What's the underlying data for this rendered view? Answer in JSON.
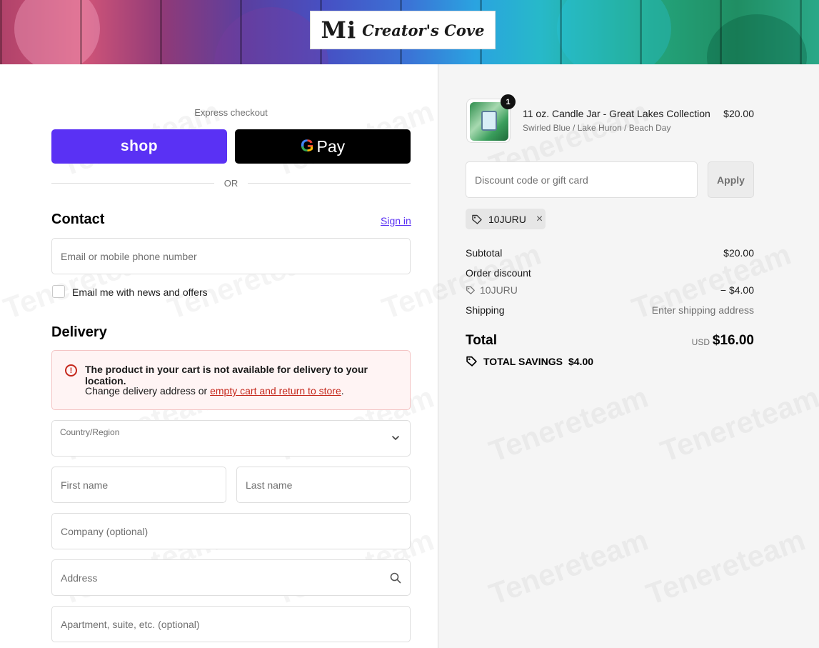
{
  "header": {
    "logo_main": "Mi",
    "logo_sub": "Creator's Cove"
  },
  "express": {
    "label": "Express checkout",
    "shop_label": "shop",
    "gpay_g": "G",
    "gpay_label": "Pay",
    "or_label": "OR"
  },
  "contact": {
    "heading": "Contact",
    "sign_in": "Sign in",
    "email_placeholder": "Email or mobile phone number",
    "newsletter_label": "Email me with news and offers"
  },
  "delivery": {
    "heading": "Delivery",
    "alert_title": "The product in your cart is not available for delivery to your location.",
    "alert_msg_prefix": "Change delivery address or ",
    "alert_link": "empty cart and return to store",
    "alert_msg_suffix": ".",
    "country_label": "Country/Region",
    "country_value": "",
    "first_name_placeholder": "First name",
    "last_name_placeholder": "Last name",
    "company_placeholder": "Company (optional)",
    "address_placeholder": "Address",
    "apartment_placeholder": "Apartment, suite, etc. (optional)"
  },
  "cart": {
    "item": {
      "quantity": "1",
      "name": "11 oz. Candle Jar - Great Lakes Collection",
      "variant": "Swirled Blue / Lake Huron / Beach Day",
      "price": "$20.00"
    },
    "discount_placeholder": "Discount code or gift card",
    "apply_label": "Apply",
    "applied_code": "10JURU",
    "remove_icon": "×"
  },
  "summary": {
    "subtotal_label": "Subtotal",
    "subtotal_value": "$20.00",
    "order_discount_label": "Order discount",
    "discount_code": "10JURU",
    "discount_value": "− $4.00",
    "shipping_label": "Shipping",
    "shipping_value": "Enter shipping address",
    "total_label": "Total",
    "currency": "USD",
    "total_value": "$16.00",
    "savings_label": "TOTAL SAVINGS",
    "savings_value": "$4.00"
  },
  "watermark": "Tenereteam",
  "colors": {
    "shop_purple": "#5a31f4",
    "error_red": "#c5281c",
    "panel_gray": "#f5f5f5"
  }
}
